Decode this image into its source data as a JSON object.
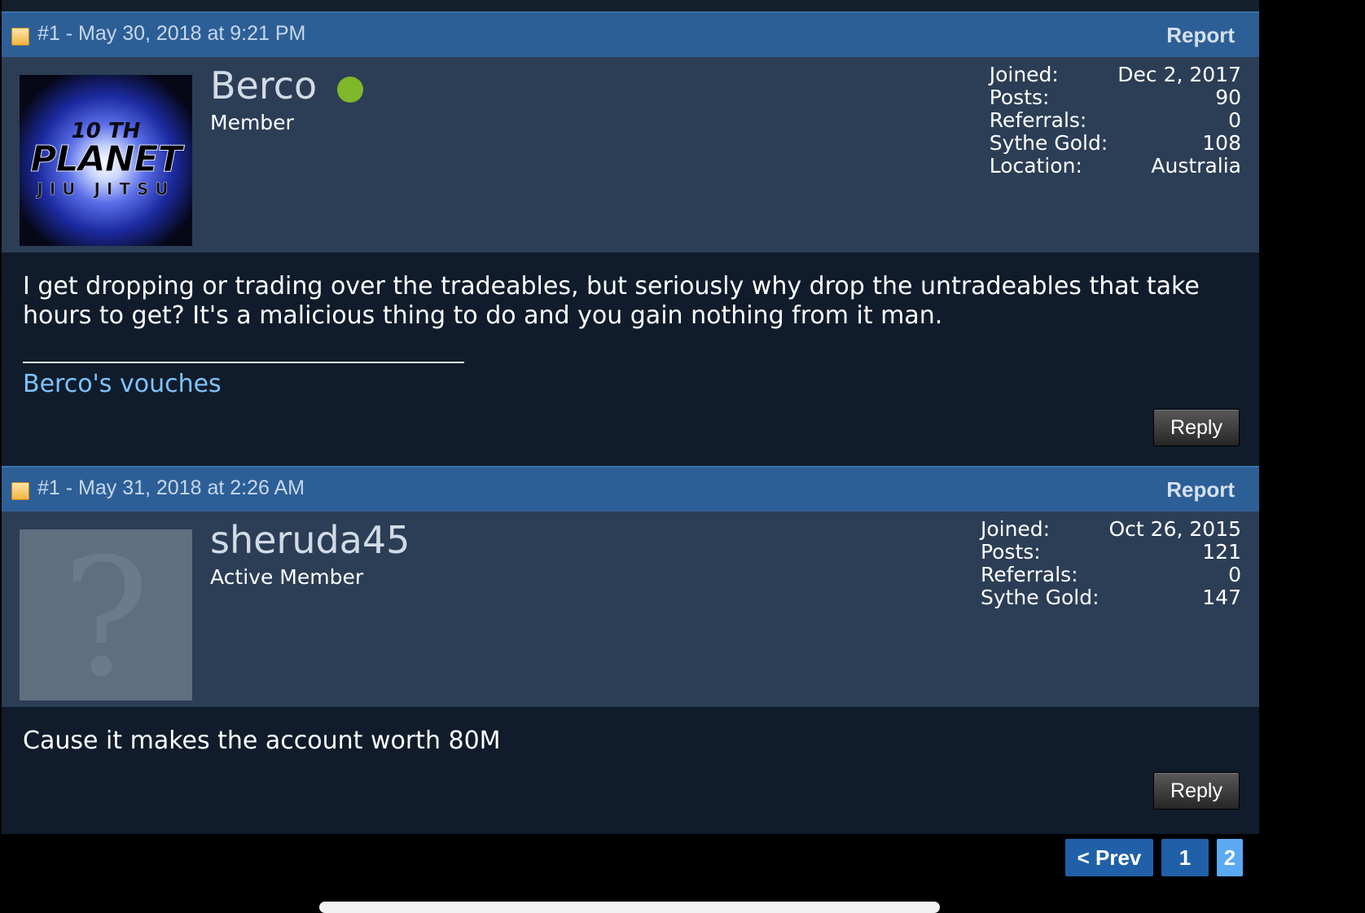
{
  "posts": [
    {
      "post_id": "#1 - May 30, 2018 at 9:21 PM",
      "report_label": "Report",
      "username": "Berco",
      "rank": "Member",
      "avatar": {
        "line1": "10 TH",
        "line2": "PLANET",
        "line3": "JIU JITSU"
      },
      "stats": [
        {
          "label": "Joined:",
          "value": "Dec 2, 2017"
        },
        {
          "label": "Posts:",
          "value": "90"
        },
        {
          "label": "Referrals:",
          "value": "0"
        },
        {
          "label": "Sythe Gold:",
          "value": "108"
        },
        {
          "label": "Location:",
          "value": "Australia"
        }
      ],
      "text": "I get dropping or trading over the tradeables, but seriously why drop the untradeables that take hours to get? It's a malicious thing to do and you gain nothing from it man.",
      "signature_link": "Berco's vouches",
      "reply_label": "Reply"
    },
    {
      "post_id": "#1 - May 31, 2018 at 2:26 AM",
      "report_label": "Report",
      "username": "sheruda45",
      "rank": "Active Member",
      "avatar_glyph": "?",
      "stats": [
        {
          "label": "Joined:",
          "value": "Oct 26, 2015"
        },
        {
          "label": "Posts:",
          "value": "121"
        },
        {
          "label": "Referrals:",
          "value": "0"
        },
        {
          "label": "Sythe Gold:",
          "value": "147"
        }
      ],
      "text": "Cause it makes the account worth 80M",
      "reply_label": "Reply"
    }
  ],
  "pagination": {
    "prev_label": "< Prev",
    "pages": [
      "1",
      "2"
    ],
    "current_page": "2"
  },
  "colors": {
    "header_bar": "#2d5f97",
    "user_panel": "#2c3e56",
    "body_panel": "#101c2b",
    "online": "#7fb72a",
    "link": "#7ec3ff",
    "page_current": "#5aa9f2"
  }
}
